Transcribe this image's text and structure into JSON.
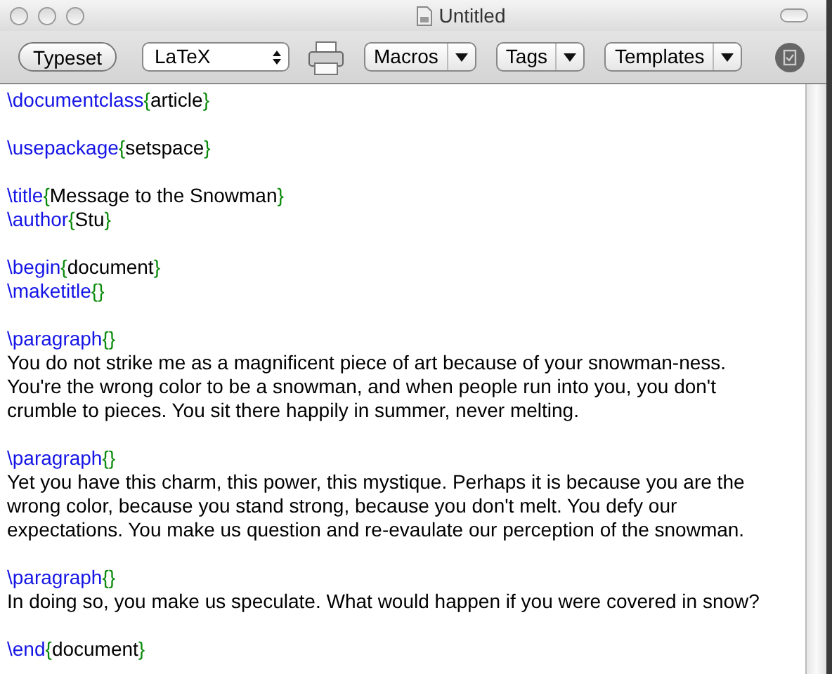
{
  "window": {
    "title": "Untitled"
  },
  "toolbar": {
    "typeset_button": "Typeset",
    "engine_popup": "LaTeX",
    "menus": [
      "Macros",
      "Tags",
      "Templates"
    ]
  },
  "editor": {
    "blocks": [
      [
        [
          {
            "kind": "command",
            "text": "\\documentclass"
          },
          {
            "kind": "brace",
            "text": "{"
          },
          {
            "kind": "text",
            "text": "article"
          },
          {
            "kind": "brace",
            "text": "}"
          }
        ]
      ],
      [
        [
          {
            "kind": "command",
            "text": "\\usepackage"
          },
          {
            "kind": "brace",
            "text": "{"
          },
          {
            "kind": "text",
            "text": "setspace"
          },
          {
            "kind": "brace",
            "text": "}"
          }
        ]
      ],
      [
        [
          {
            "kind": "command",
            "text": "\\title"
          },
          {
            "kind": "brace",
            "text": "{"
          },
          {
            "kind": "text",
            "text": "Message to the Snowman"
          },
          {
            "kind": "brace",
            "text": "}"
          }
        ],
        [
          {
            "kind": "command",
            "text": "\\author"
          },
          {
            "kind": "brace",
            "text": "{"
          },
          {
            "kind": "text",
            "text": "Stu"
          },
          {
            "kind": "brace",
            "text": "}"
          }
        ]
      ],
      [
        [
          {
            "kind": "command",
            "text": "\\begin"
          },
          {
            "kind": "brace",
            "text": "{"
          },
          {
            "kind": "text",
            "text": "document"
          },
          {
            "kind": "brace",
            "text": "}"
          }
        ],
        [
          {
            "kind": "command",
            "text": "\\maketitle"
          },
          {
            "kind": "brace",
            "text": "{}"
          }
        ]
      ],
      [
        [
          {
            "kind": "command",
            "text": "\\paragraph"
          },
          {
            "kind": "brace",
            "text": "{}"
          }
        ],
        [
          {
            "kind": "text",
            "text": "You do not strike me as a magnificent piece of art because of your snowman-ness."
          }
        ],
        [
          {
            "kind": "text",
            "text": "You're the wrong color to be a snowman, and when people run into you, you don't"
          }
        ],
        [
          {
            "kind": "text",
            "text": "crumble to pieces. You sit there happily in summer, never melting."
          }
        ]
      ],
      [
        [
          {
            "kind": "command",
            "text": "\\paragraph"
          },
          {
            "kind": "brace",
            "text": "{}"
          }
        ],
        [
          {
            "kind": "text",
            "text": "Yet you have this charm, this power, this mystique. Perhaps it is because you are the"
          }
        ],
        [
          {
            "kind": "text",
            "text": "wrong color, because you stand strong, because you don't melt. You defy our"
          }
        ],
        [
          {
            "kind": "text",
            "text": "expectations. You make us question and re-evaulate our perception of the snowman."
          }
        ]
      ],
      [
        [
          {
            "kind": "command",
            "text": "\\paragraph"
          },
          {
            "kind": "brace",
            "text": "{}"
          }
        ],
        [
          {
            "kind": "text",
            "text": "In doing so, you make us speculate. What would happen if you were covered in snow?"
          }
        ]
      ],
      [
        [
          {
            "kind": "command",
            "text": "\\end"
          },
          {
            "kind": "brace",
            "text": "{"
          },
          {
            "kind": "text",
            "text": "document"
          },
          {
            "kind": "brace",
            "text": "}"
          }
        ]
      ]
    ]
  }
}
